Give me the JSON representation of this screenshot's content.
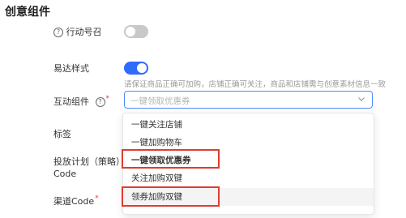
{
  "section": {
    "title": "创意组件"
  },
  "fields": {
    "action_call": {
      "label": "行动号召",
      "help": "?"
    },
    "easy_style": {
      "label": "易达样式"
    },
    "hint_text": "请保证商品正确可加购，店铺正确可关注，商品和店铺需与创意素材信息一致",
    "interactive": {
      "label": "互动组件",
      "help": "?",
      "required_mark": "*",
      "placeholder": "一键领取优惠券"
    },
    "tag": {
      "label": "标签"
    },
    "plan_code": {
      "label_line1": "投放计划（策略）",
      "label_line2": "Code"
    },
    "channel": {
      "label": "渠道Code",
      "required_mark": "*"
    }
  },
  "toggles": {
    "action_call": {
      "state": "off",
      "color": "#c8c8c8"
    },
    "easy_style": {
      "state": "on",
      "color": "#2f6bff"
    }
  },
  "dropdown": {
    "options": [
      {
        "label": "一键关注店铺"
      },
      {
        "label": "一键加购物车"
      },
      {
        "label": "一键领取优惠券"
      },
      {
        "label": "关注加购双键"
      },
      {
        "label": "领券加购双键"
      }
    ]
  },
  "colors": {
    "accent": "#2f6bff",
    "highlight_box": "#e03c2e"
  },
  "icons": {
    "chevron": "chevron-down-icon",
    "help": "help-circle-icon"
  }
}
